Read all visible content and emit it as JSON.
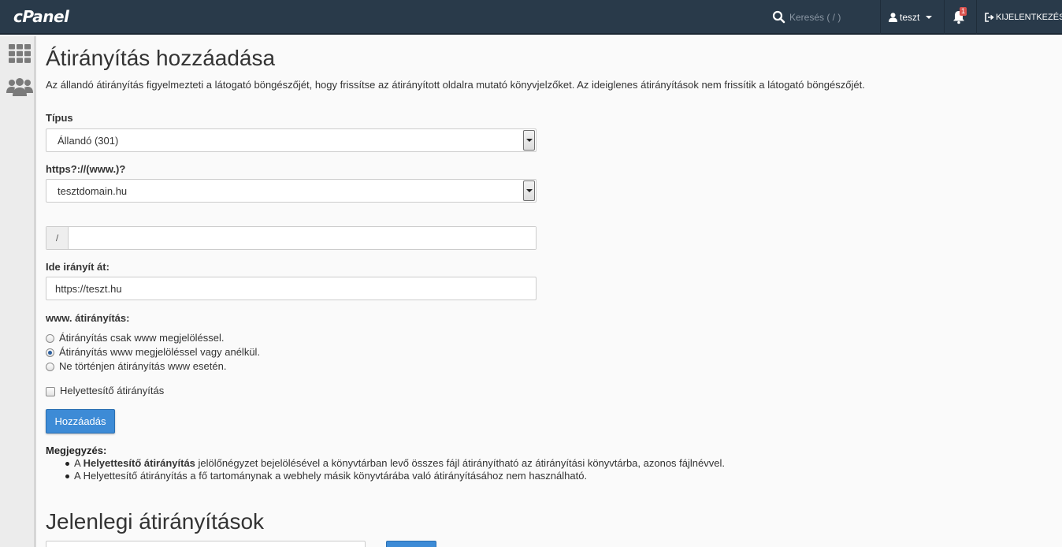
{
  "topbar": {
    "logo": "cPanel",
    "search_placeholder": "Keresés ( / )",
    "user": "teszt",
    "notification_count": "1",
    "logout": "KIJELENTKEZÉS"
  },
  "sidebar": {
    "items": [
      {
        "icon": "grid-icon"
      },
      {
        "icon": "users-icon"
      }
    ]
  },
  "page": {
    "title": "Átirányítás hozzáadása",
    "description": "Az állandó átirányítás figyelmezteti a látogató böngészőjét, hogy frissítse az átirányított oldalra mutató könyvjelzőket. Az ideiglenes átirányítások nem frissítik a látogató böngészőjét."
  },
  "form": {
    "type_label": "Típus",
    "type_value": "Állandó (301)",
    "domain_label": "https?://(www.)?",
    "domain_value": "tesztdomain.hu",
    "path_prefix": "/",
    "path_value": "",
    "target_label": "Ide irányít át:",
    "target_value": "https://teszt.hu",
    "www_label": "www. átirányítás:",
    "www_options": [
      {
        "label": "Átirányítás csak www megjelöléssel.",
        "checked": false
      },
      {
        "label": "Átirányítás www megjelöléssel vagy anélkül.",
        "checked": true
      },
      {
        "label": "Ne történjen átirányítás www esetén.",
        "checked": false
      }
    ],
    "wildcard_label": "Helyettesítő átirányítás",
    "wildcard_checked": false,
    "submit_label": "Hozzáadás"
  },
  "note": {
    "title": "Megjegyzés:",
    "item1_prefix": "A ",
    "item1_bold": "Helyettesítő átirányítás",
    "item1_rest": " jelölőnégyzet bejelölésével a könyvtárban levő összes fájl átirányítható az átirányítási könyvtárba, azonos fájlnévvel.",
    "item2": "A Helyettesítő átirányítás a fő tartománynak a webhely másik könyvtárába való átirányításához nem használható."
  },
  "current": {
    "title": "Jelenlegi átirányítások"
  }
}
